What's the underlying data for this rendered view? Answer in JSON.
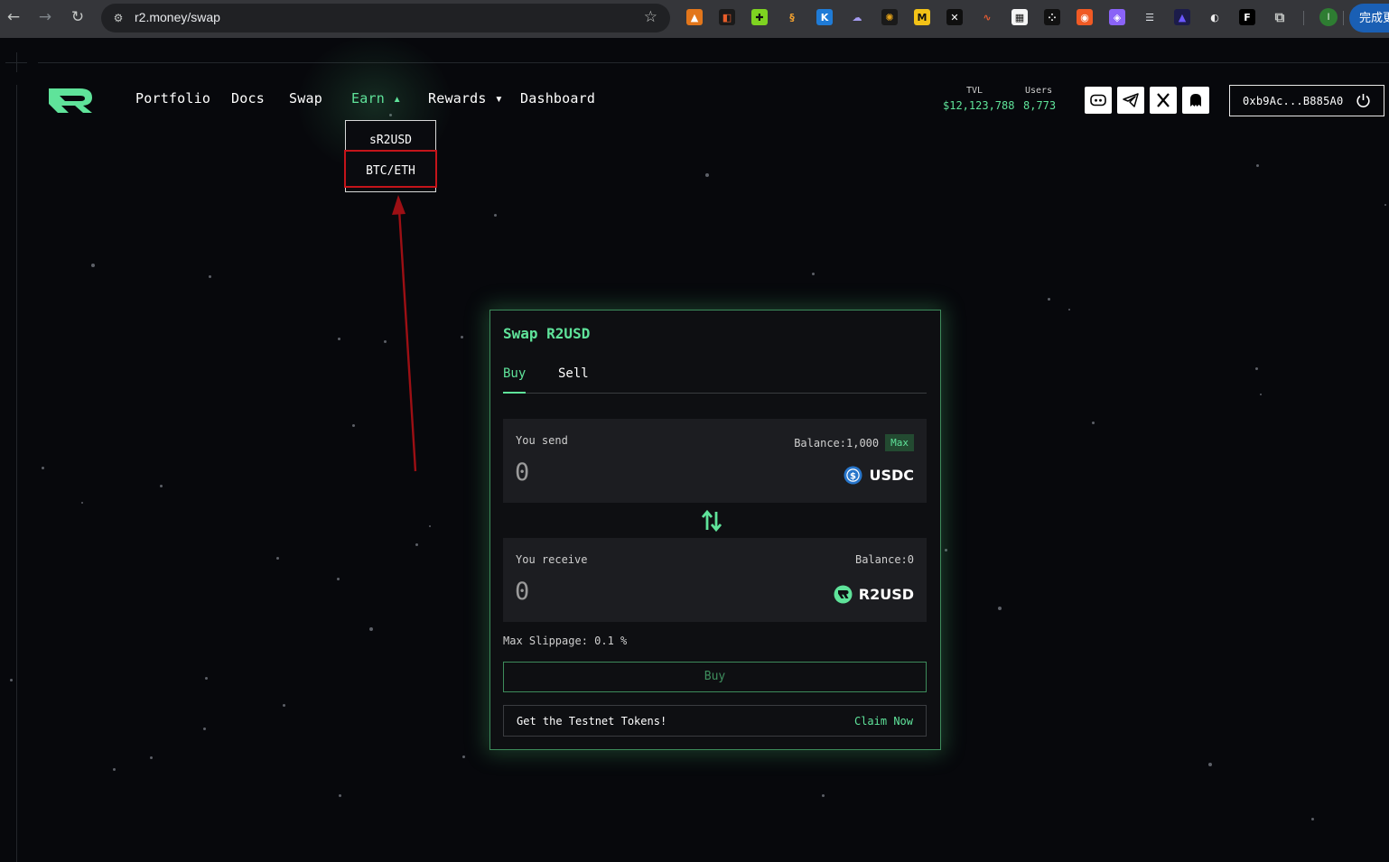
{
  "browser": {
    "url": "r2.money/swap",
    "finish_label": "完成更新",
    "profile_initial": "I"
  },
  "header": {
    "nav": [
      {
        "label": "Portfolio"
      },
      {
        "label": "Docs"
      },
      {
        "label": "Swap"
      },
      {
        "label": "Earn ▴"
      },
      {
        "label": "Rewards ▾"
      },
      {
        "label": "Dashboard"
      }
    ],
    "earn_dropdown": [
      "sR2USD",
      "BTC/ETH"
    ],
    "stats": {
      "tvl_label": "TVL",
      "tvl_value": "$12,123,788",
      "users_label": "Users",
      "users_value": "8,773"
    },
    "wallet_address": "0xb9Ac...B885A0"
  },
  "swap": {
    "title": "Swap R2USD",
    "tabs": [
      "Buy",
      "Sell"
    ],
    "send": {
      "label": "You send",
      "balance": "Balance:1,000",
      "max_label": "Max",
      "amount": "0",
      "token": "USDC"
    },
    "receive": {
      "label": "You receive",
      "balance": "Balance:0",
      "amount": "0",
      "token": "R2USD"
    },
    "slippage": "Max Slippage: 0.1 %",
    "action_label": "Buy",
    "faucet_text": "Get the Testnet Tokens!",
    "faucet_link": "Claim Now"
  },
  "colors": {
    "accent": "#5fe39a",
    "background": "#07080c",
    "annotation": "#c4141a"
  }
}
